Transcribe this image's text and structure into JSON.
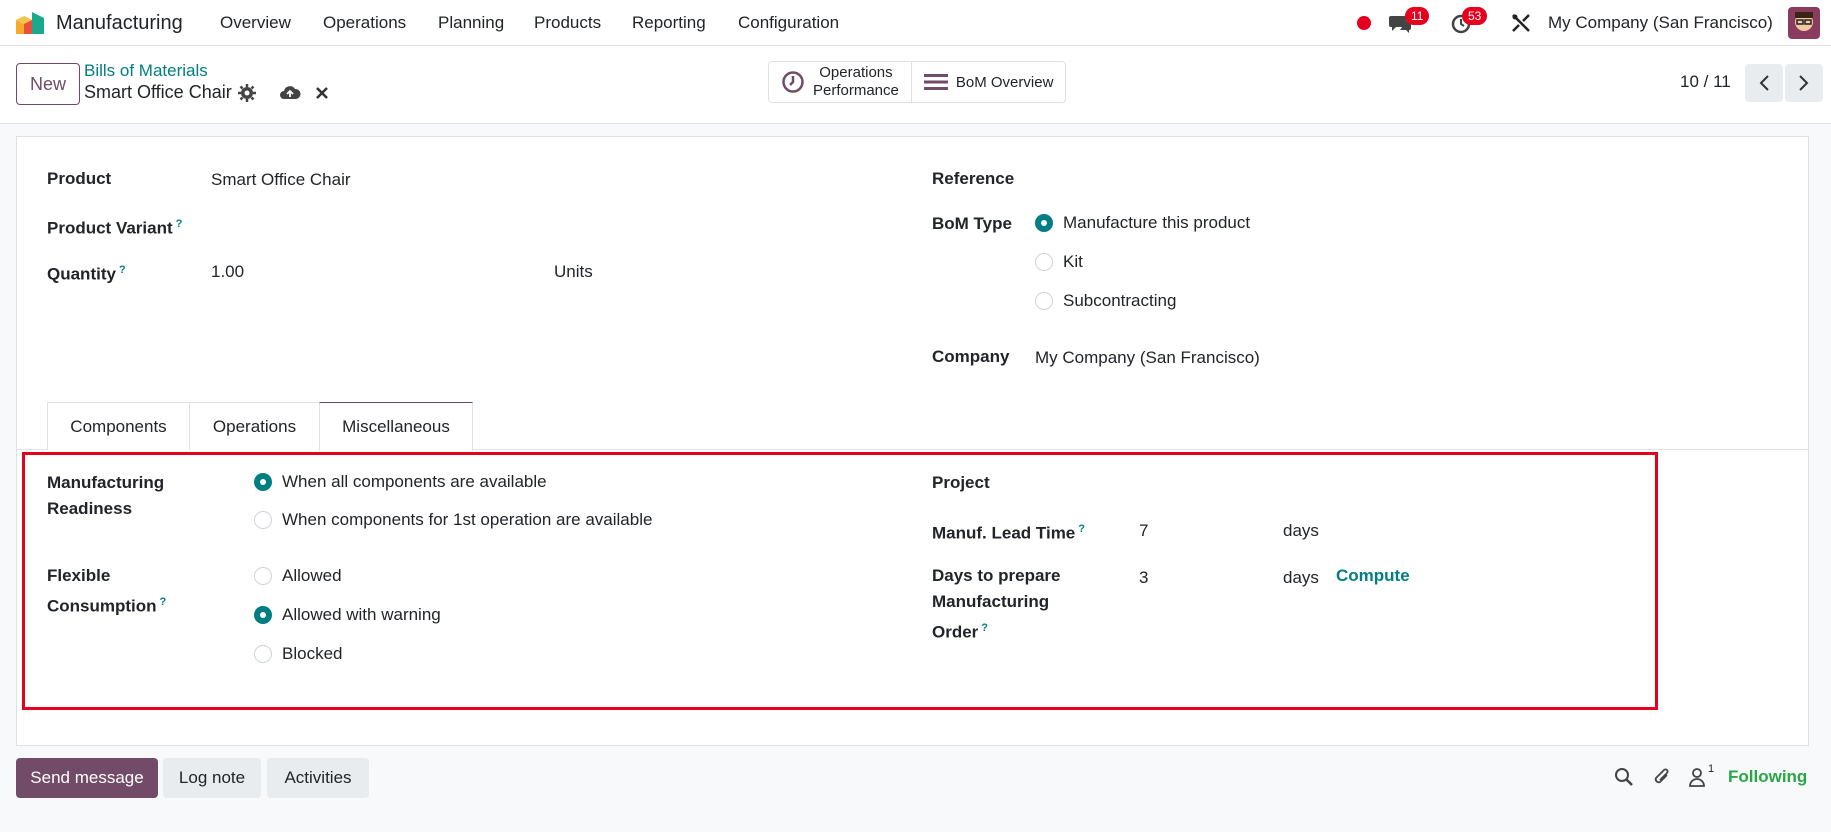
{
  "navbar": {
    "app_name": "Manufacturing",
    "menu": [
      "Overview",
      "Operations",
      "Planning",
      "Products",
      "Reporting",
      "Configuration"
    ],
    "messages_count": "11",
    "activities_count": "53",
    "company": "My Company (San Francisco)"
  },
  "control_panel": {
    "new_label": "New",
    "breadcrumb_parent": "Bills of Materials",
    "record_title": "Smart Office Chair",
    "smart_buttons": {
      "ops_perf_line1": "Operations",
      "ops_perf_line2": "Performance",
      "bom_overview": "BoM Overview"
    },
    "pager": "10 / 11"
  },
  "form": {
    "product_label": "Product",
    "product_value": "Smart Office Chair",
    "variant_label": "Product Variant",
    "quantity_label": "Quantity",
    "quantity_value": "1.00",
    "uom_value": "Units",
    "reference_label": "Reference",
    "bom_type_label": "BoM Type",
    "bom_types": [
      "Manufacture this product",
      "Kit",
      "Subcontracting"
    ],
    "bom_type_selected": "Manufacture this product",
    "company_label": "Company",
    "company_value": "My Company (San Francisco)",
    "help_mark": "?"
  },
  "tabs": [
    "Components",
    "Operations",
    "Miscellaneous"
  ],
  "active_tab": "Miscellaneous",
  "misc": {
    "readiness_label_1": "Manufacturing",
    "readiness_label_2": "Readiness",
    "readiness_options": [
      "When all components are available",
      "When components for 1st operation are available"
    ],
    "readiness_selected": "When all components are available",
    "flex_label_1": "Flexible",
    "flex_label_2": "Consumption",
    "flex_options": [
      "Allowed",
      "Allowed with warning",
      "Blocked"
    ],
    "flex_selected": "Allowed with warning",
    "project_label": "Project",
    "lead_time_label": "Manuf. Lead Time",
    "lead_time_value": "7",
    "lead_time_unit": "days",
    "prepare_label_1": "Days to prepare",
    "prepare_label_2": "Manufacturing",
    "prepare_label_3": "Order",
    "prepare_value": "3",
    "prepare_unit": "days",
    "compute_label": "Compute"
  },
  "chatter": {
    "send_message": "Send message",
    "log_note": "Log note",
    "activities": "Activities",
    "followers_count": "1",
    "following": "Following"
  },
  "colors": {
    "brand": "#714b67",
    "accent": "#017e84",
    "badge": "#e6001e",
    "following": "#28a745"
  }
}
